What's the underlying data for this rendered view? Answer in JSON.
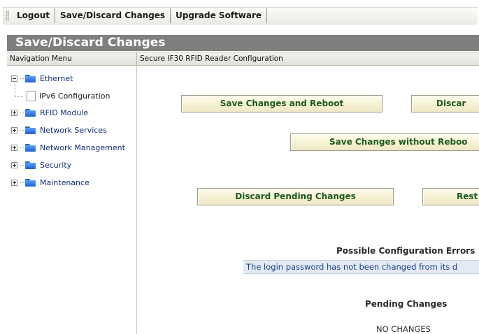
{
  "toolbar": {
    "buttons": [
      "Logout",
      "Save/Discard Changes",
      "Upgrade Software"
    ]
  },
  "title": "Save/Discard Changes",
  "headers": {
    "navigation": "Navigation Menu",
    "content": "Secure IF30 RFID Reader Configuration"
  },
  "nav": {
    "items": [
      {
        "label": "Ethernet",
        "icon": "folder-icon",
        "expander": "minus"
      },
      {
        "label": "IPv6 Configuration",
        "icon": "page-icon"
      },
      {
        "label": "RFID Module",
        "icon": "folder-icon",
        "expander": "plus"
      },
      {
        "label": "Network Services",
        "icon": "folder-icon",
        "expander": "plus"
      },
      {
        "label": "Network Management",
        "icon": "folder-icon",
        "expander": "plus"
      },
      {
        "label": "Security",
        "icon": "folder-icon",
        "expander": "plus"
      },
      {
        "label": "Maintenance",
        "icon": "folder-icon",
        "expander": "plus"
      }
    ]
  },
  "content": {
    "buttons": {
      "save_reboot": "Save Changes and Reboot",
      "discard_top": "Discar",
      "save_no_reboot": "Save Changes without Reboo",
      "discard_pending": "Discard Pending Changes",
      "restore": "Rest"
    },
    "errors_title": "Possible Configuration Errors",
    "error_message": "The login password has not been changed from its d",
    "pending_title": "Pending Changes",
    "pending_value": "NO CHANGES"
  },
  "colors": {
    "title_bar": "#7f7f7f",
    "button_text": "#1d5a1d",
    "nav_link": "#14307a",
    "error_strip": "#e3eaf3"
  }
}
